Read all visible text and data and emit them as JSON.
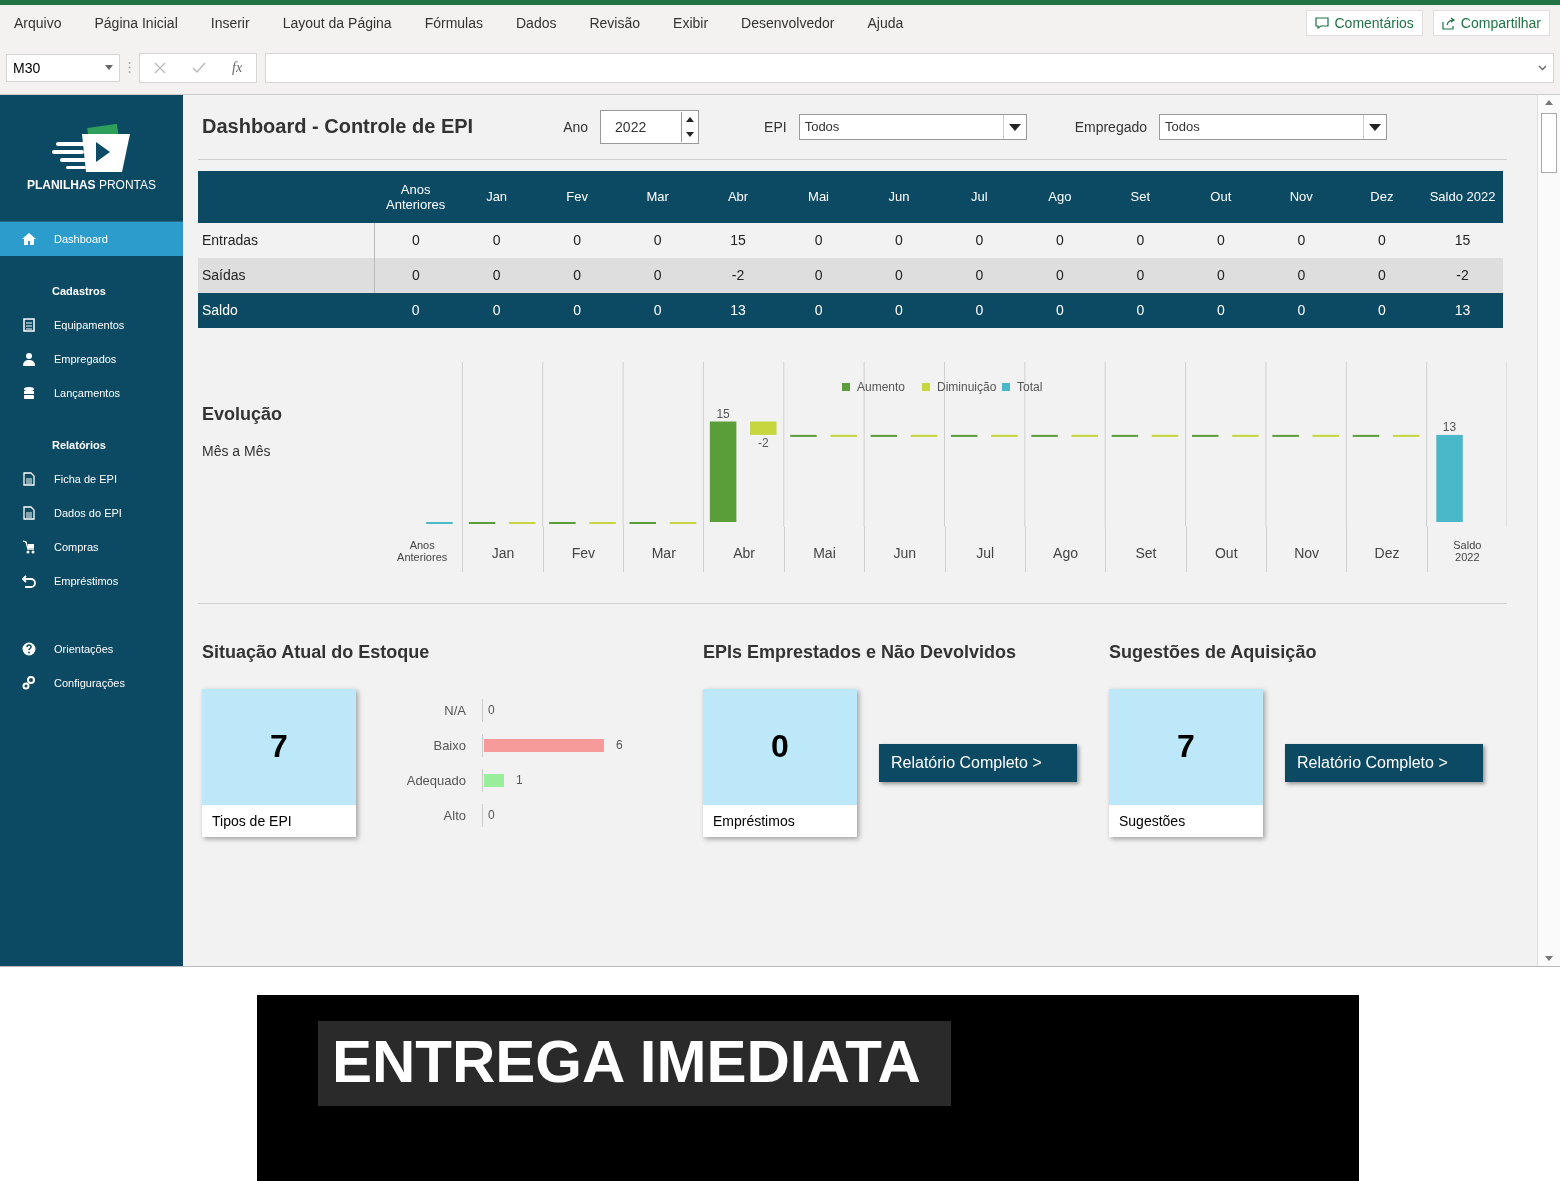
{
  "ribbon": {
    "tabs": [
      {
        "label": "Arquivo",
        "selected": false
      },
      {
        "label": "Página Inicial",
        "selected": false
      },
      {
        "label": "Inserir",
        "selected": false
      },
      {
        "label": "Layout da Página",
        "selected": false
      },
      {
        "label": "Fórmulas",
        "selected": false
      },
      {
        "label": "Dados",
        "selected": false
      },
      {
        "label": "Revisão",
        "selected": false
      },
      {
        "label": "Exibir",
        "selected": false
      },
      {
        "label": "Desenvolvedor",
        "selected": false
      },
      {
        "label": "Ajuda",
        "selected": false
      }
    ],
    "buttons": [
      "Comentários",
      "Compartilhar"
    ]
  },
  "formula_bar": {
    "name_box": "M30",
    "fx": "fx"
  },
  "sidebar": {
    "logo_text": "**PLANILHAS** PRONTAS",
    "items": [
      {
        "kind": "link",
        "label": "Dashboard",
        "selected": true
      },
      {
        "kind": "heading",
        "label": "Cadastros"
      },
      {
        "kind": "link",
        "label": "Equipamentos",
        "selected": false
      },
      {
        "kind": "link",
        "label": "Empregados",
        "selected": false
      },
      {
        "kind": "link",
        "label": "Lançamentos",
        "selected": false
      },
      {
        "kind": "heading",
        "label": "Relatórios"
      },
      {
        "kind": "link",
        "label": "Ficha de EPI",
        "selected": false
      },
      {
        "kind": "link",
        "label": "Dados do EPI",
        "selected": false
      },
      {
        "kind": "link",
        "label": "Compras",
        "selected": false
      },
      {
        "kind": "link",
        "label": "Empréstimos",
        "selected": false
      },
      {
        "kind": "spacer"
      },
      {
        "kind": "link",
        "label": "Orientações",
        "selected": false
      },
      {
        "kind": "link",
        "label": "Configurações",
        "selected": false
      }
    ]
  },
  "header": {
    "title": "Dashboard - Controle de EPI",
    "filters": [
      {
        "kind": "spinner",
        "label": "Ano",
        "value": "2022"
      },
      {
        "kind": "dropdown",
        "label": "EPI",
        "value": "Todos"
      },
      {
        "kind": "dropdown",
        "label": "Empregado",
        "value": "Todos"
      }
    ]
  },
  "table": {
    "columns": [
      "Anos Anteriores",
      "Jan",
      "Fev",
      "Mar",
      "Abr",
      "Mai",
      "Jun",
      "Jul",
      "Ago",
      "Set",
      "Out",
      "Nov",
      "Dez",
      "Saldo 2022"
    ],
    "rows": [
      {
        "kind": "normal",
        "label": "Entradas",
        "cells": [
          "0",
          "0",
          "0",
          "0",
          "15",
          "0",
          "0",
          "0",
          "0",
          "0",
          "0",
          "0",
          "0",
          "15"
        ]
      },
      {
        "kind": "shaded",
        "label": "Saídas",
        "cells": [
          "0",
          "0",
          "0",
          "0",
          "-2",
          "0",
          "0",
          "0",
          "0",
          "0",
          "0",
          "0",
          "0",
          "-2"
        ]
      },
      {
        "kind": "total",
        "label": "Saldo",
        "cells": [
          "0",
          "0",
          "0",
          "0",
          "13",
          "0",
          "0",
          "0",
          "0",
          "0",
          "0",
          "0",
          "0",
          "13"
        ]
      }
    ]
  },
  "evolution": {
    "title": "Evolução",
    "subtitle": "Mês a Mês",
    "chart": {
      "categories": [
        "Anos Anteriores",
        "Jan",
        "Fev",
        "Mar",
        "Abr",
        "Mai",
        "Jun",
        "Jul",
        "Ago",
        "Set",
        "Out",
        "Nov",
        "Dez",
        "Saldo 2022"
      ],
      "legend": [
        {
          "name": "Aumento",
          "color": "#5a9e3a"
        },
        {
          "name": "Diminuição",
          "color": "#c5d63f"
        },
        {
          "name": "Total",
          "color": "#4bb8c9"
        }
      ],
      "bar_labels": [
        "15",
        "-2",
        "13"
      ]
    }
  },
  "stock": {
    "title": "Situação Atual do Estoque",
    "card": {
      "value": "7",
      "caption": "Tipos de EPI"
    },
    "chart_data": {
      "type": "bar",
      "orientation": "horizontal",
      "categories": [
        "N/A",
        "Baixo",
        "Adequado",
        "Alto"
      ],
      "data_labels": true,
      "values": [
        0,
        6,
        1,
        0
      ]
    }
  },
  "loans": {
    "title": "EPIs Emprestados e Não Devolvidos",
    "card": {
      "value": "0",
      "caption": "Empréstimos"
    },
    "button": "Relatório Completo >"
  },
  "suggestions": {
    "title": "Sugestões de Aquisição",
    "card": {
      "value": "7",
      "caption": "Sugestões"
    },
    "button": "Relatório Completo >"
  },
  "banner": {
    "text": "ENTREGA IMEDIATA"
  }
}
